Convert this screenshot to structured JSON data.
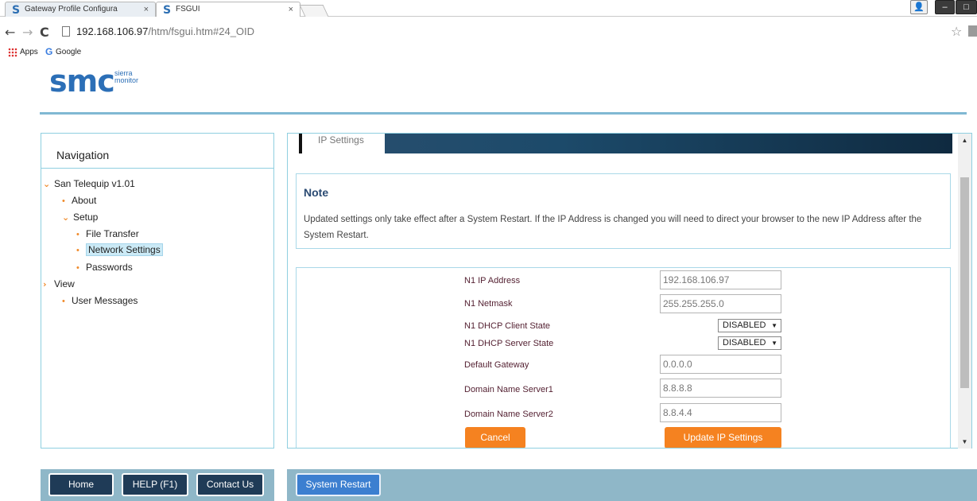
{
  "browser": {
    "tabs": [
      {
        "title": "Gateway Profile Configura",
        "close": "×"
      },
      {
        "title": "FSGUI",
        "close": "×"
      }
    ],
    "url_host": "192.168.106.97",
    "url_path": "/htm/fsgui.htm#24_OID",
    "bookmarks": {
      "apps": "Apps",
      "google": "Google"
    }
  },
  "header": {
    "logo_mark": "smc",
    "logo_sub_1": "sierra",
    "logo_sub_2": "monitor",
    "accent_color": "#2c6fb7"
  },
  "navigation": {
    "title": "Navigation",
    "tree": {
      "root": "San Telequip v1.01",
      "about": "About",
      "setup": "Setup",
      "file_transfer": "File Transfer",
      "network_settings": "Network Settings",
      "passwords": "Passwords",
      "view": "View",
      "user_messages": "User Messages"
    }
  },
  "main": {
    "tab_label": "IP Settings",
    "note": {
      "title": "Note",
      "text": "Updated settings only take effect after a System Restart. If the IP Address is changed you will need to direct your browser to the new IP Address after the System Restart."
    },
    "form": {
      "ip_address": {
        "label": "N1 IP Address",
        "value": "192.168.106.97"
      },
      "netmask": {
        "label": "N1 Netmask",
        "value": "255.255.255.0"
      },
      "dhcp_client": {
        "label": "N1 DHCP Client State",
        "value": "DISABLED"
      },
      "dhcp_server": {
        "label": "N1 DHCP Server State",
        "value": "DISABLED"
      },
      "gateway": {
        "label": "Default Gateway",
        "value": "0.0.0.0"
      },
      "dns1": {
        "label": "Domain Name Server1",
        "value": "8.8.8.8"
      },
      "dns2": {
        "label": "Domain Name Server2",
        "value": "8.8.4.4"
      },
      "cancel_label": "Cancel",
      "update_label": "Update IP Settings"
    }
  },
  "footer": {
    "home": "Home",
    "help": "HELP (F1)",
    "contact": "Contact Us",
    "restart": "System Restart"
  },
  "colors": {
    "orange": "#f58220",
    "dark_button": "#1f3b57",
    "restart_button": "#3c7fd0",
    "footer_bar": "#8fb7c8"
  }
}
